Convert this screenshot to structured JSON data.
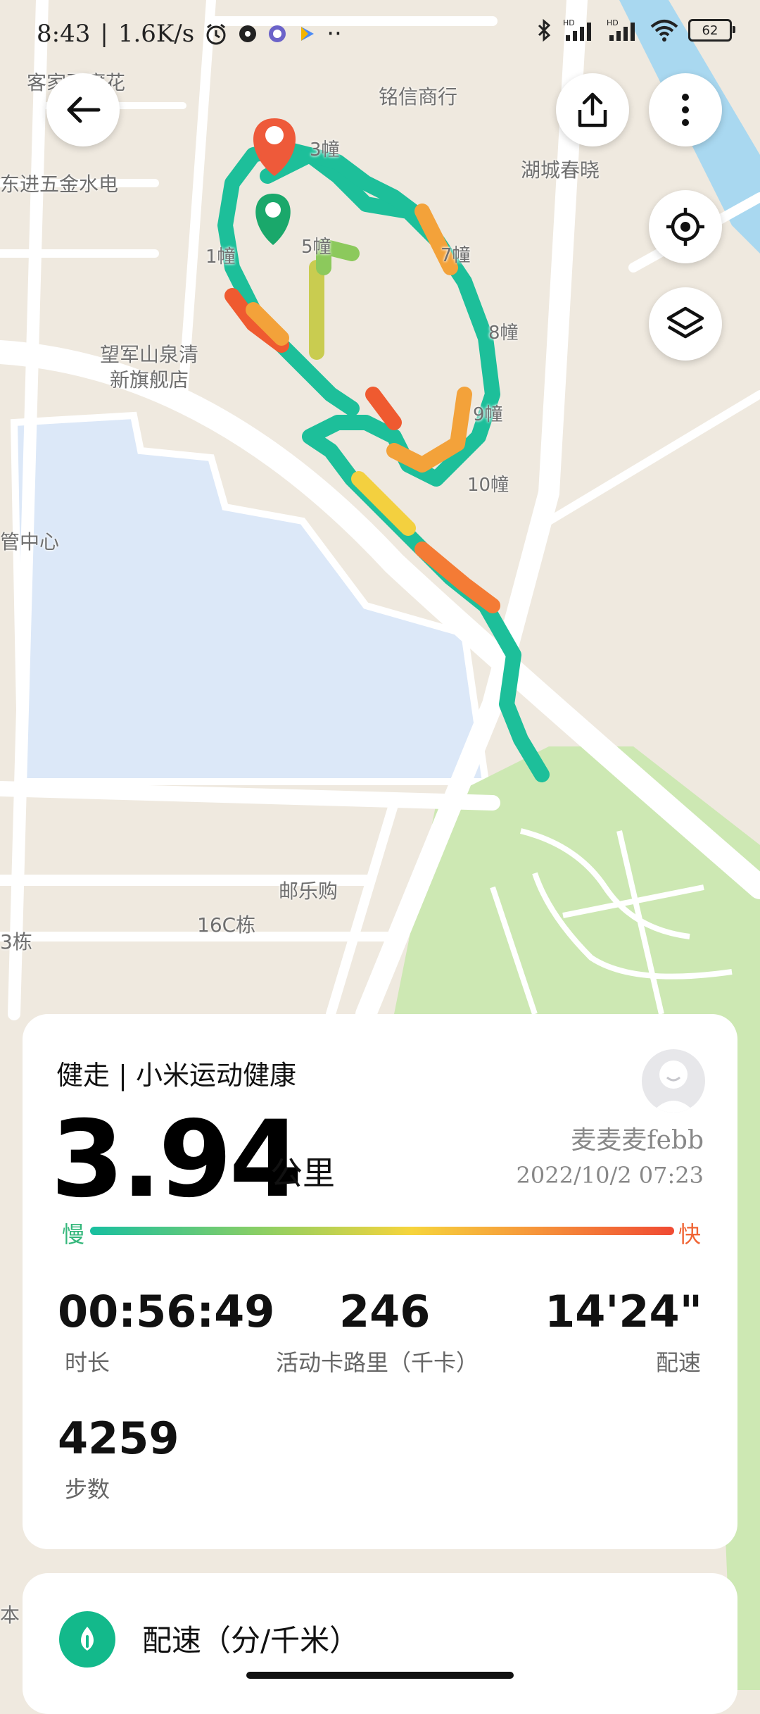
{
  "statusbar": {
    "time": "8:43",
    "net_speed": "1.6K/s",
    "battery": "62"
  },
  "map": {
    "labels": [
      {
        "text": "客家豆腐花"
      },
      {
        "text": "铭信商行"
      },
      {
        "text": "3幢"
      },
      {
        "text": "湖城春晓"
      },
      {
        "text": "东进五金水电"
      },
      {
        "text": "1幢"
      },
      {
        "text": "5幢"
      },
      {
        "text": "7幢"
      },
      {
        "text": "8幢"
      },
      {
        "text": "望军山泉清"
      },
      {
        "text": "新旗舰店"
      },
      {
        "text": "9幢"
      },
      {
        "text": "10幢"
      },
      {
        "text": "管中心"
      },
      {
        "text": "邮乐购"
      },
      {
        "text": "16C栋"
      },
      {
        "text": "3栋"
      },
      {
        "text": "本"
      }
    ],
    "colors": {
      "route_slow": "#1dbf9a",
      "route_mid": "#f3d03f",
      "route_fast": "#ef5a30",
      "water": "#dce8f8",
      "park": "#cde8b3"
    }
  },
  "summary": {
    "title": "健走 | 小米运动健康",
    "distance": "3.94",
    "distance_unit": "公里",
    "user_name": "麦麦麦febb",
    "datetime": "2022/10/2 07:23",
    "slow_label": "慢",
    "fast_label": "快",
    "stats": {
      "duration": {
        "value": "00:56:49",
        "label": "时长"
      },
      "calories": {
        "value": "246",
        "label": "活动卡路里（千卡）"
      },
      "pace": {
        "value": "14'24\"",
        "label": "配速"
      },
      "steps": {
        "value": "4259",
        "label": "步数"
      }
    }
  },
  "pace_section": {
    "title": "配速（分/千米）"
  }
}
